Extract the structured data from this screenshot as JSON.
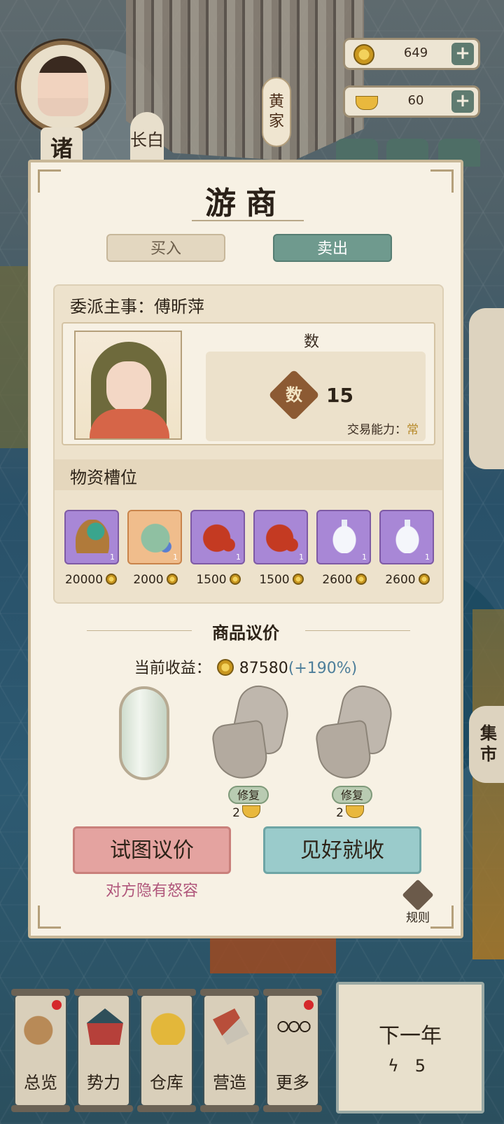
{
  "header": {
    "player_name_char": "诸",
    "city_tab": "长白",
    "family_tag": "黄家",
    "copper": "649",
    "gold": "60",
    "plus_label": "+"
  },
  "panel": {
    "title": "游商",
    "tabs": [
      {
        "label": "买入",
        "active": false
      },
      {
        "label": "卖出",
        "active": true
      }
    ],
    "manager_label": "委派主事：傅昕萍",
    "attribute": {
      "title": "数",
      "badge": "数",
      "value": "15",
      "ability_label": "交易能力：",
      "ability_value": "常"
    },
    "slots_title": "物资槽位",
    "slots": [
      {
        "item": "vegetable-basket-icon",
        "count": "1",
        "price": "20000",
        "rarity": "purple"
      },
      {
        "item": "jade-jar-icon",
        "count": "1",
        "price": "2000",
        "rarity": "orange"
      },
      {
        "item": "lacquer-jar-icon",
        "count": "1",
        "price": "1500",
        "rarity": "purple"
      },
      {
        "item": "lacquer-jar-icon",
        "count": "1",
        "price": "1500",
        "rarity": "purple"
      },
      {
        "item": "porcelain-vase-icon",
        "count": "1",
        "price": "2600",
        "rarity": "purple"
      },
      {
        "item": "porcelain-vase-icon",
        "count": "1",
        "price": "2600",
        "rarity": "purple"
      }
    ],
    "negotiation_title": "商品议价",
    "profit_label": "当前收益：",
    "profit_value": "87580",
    "profit_pct": "(+190%)",
    "repair_label": "修复",
    "repair_cost_1": "2",
    "repair_cost_2": "2",
    "try_button": "试图议价",
    "accept_button": "见好就收",
    "warning": "对方隐有怒容",
    "rules": "规则"
  },
  "bottom_nav": [
    {
      "label": "总览",
      "icon": "scroll-brush-icon",
      "badge": true
    },
    {
      "label": "势力",
      "icon": "palace-icon",
      "badge": false
    },
    {
      "label": "仓库",
      "icon": "money-bag-icon",
      "badge": false
    },
    {
      "label": "营造",
      "icon": "trowel-bricks-icon",
      "badge": false
    },
    {
      "label": "更多",
      "icon": "more-dots-icon",
      "badge": true
    }
  ],
  "next_year": {
    "label": "下一年",
    "energy": "5"
  },
  "side_labels": {
    "market": "集市"
  }
}
